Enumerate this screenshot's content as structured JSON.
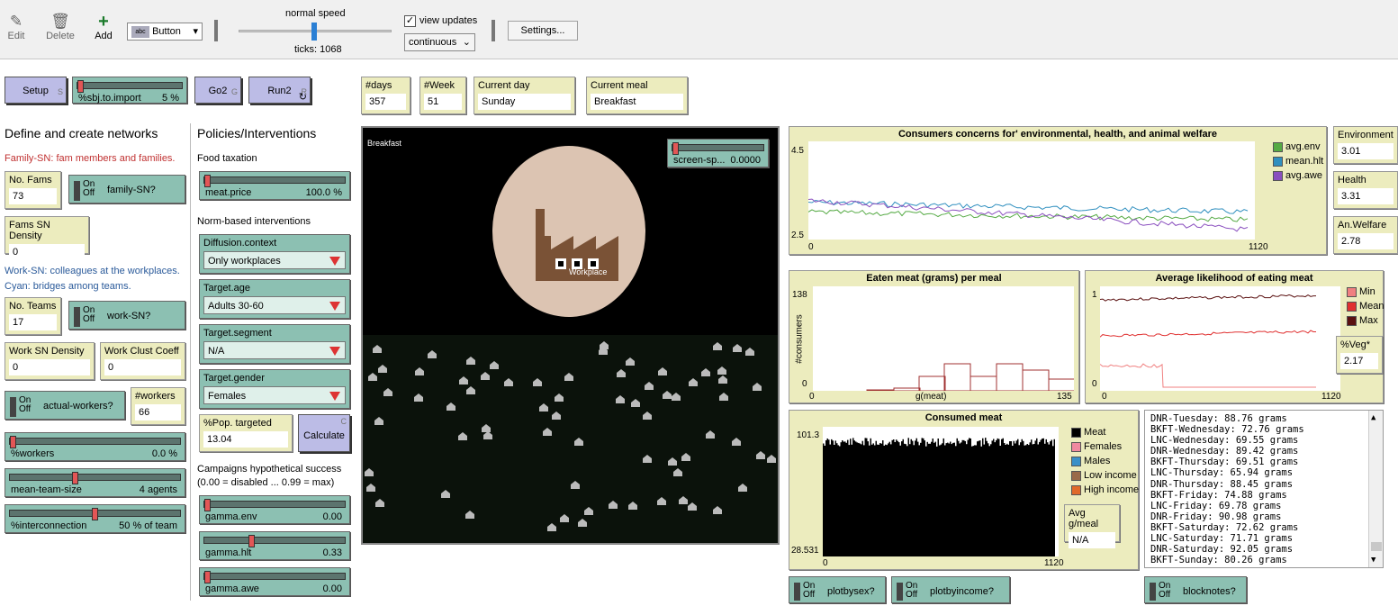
{
  "toolbar": {
    "edit": "Edit",
    "delete": "Delete",
    "add": "Add",
    "widget_type": "Button",
    "speed": "normal speed",
    "ticks": "ticks: 1068",
    "view_updates": "view updates",
    "update_mode": "continuous",
    "settings": "Settings..."
  },
  "buttons": {
    "setup": "Setup",
    "setup_key": "S",
    "go2": "Go2",
    "go2_key": "G",
    "run2": "Run2",
    "run2_key": "R",
    "calculate": "Calculate",
    "calculate_key": "C"
  },
  "monitors": {
    "days": {
      "label": "#days",
      "value": "357"
    },
    "week": {
      "label": "#Week",
      "value": "51"
    },
    "current_day": {
      "label": "Current day",
      "value": "Sunday"
    },
    "current_meal": {
      "label": "Current meal",
      "value": "Breakfast"
    },
    "no_fams": {
      "label": "No. Fams",
      "value": "73"
    },
    "fams_density": {
      "label": "Fams SN Density",
      "value": "0"
    },
    "no_teams": {
      "label": "No. Teams",
      "value": "17"
    },
    "work_density": {
      "label": "Work SN Density",
      "value": "0"
    },
    "work_clust": {
      "label": "Work Clust Coeff",
      "value": "0"
    },
    "workers": {
      "label": "#workers",
      "value": "66"
    },
    "pop_targeted": {
      "label": "%Pop. targeted",
      "value": "13.04"
    },
    "environment": {
      "label": "Environment",
      "value": "3.01"
    },
    "health": {
      "label": "Health",
      "value": "3.31"
    },
    "an_welfare": {
      "label": "An.Welfare",
      "value": "2.78"
    },
    "veg": {
      "label": "%Veg*",
      "value": "2.17"
    },
    "avg_gmeal": {
      "label": "Avg g/meal",
      "value": "N/A"
    }
  },
  "sliders": {
    "sbj_import": {
      "label": "%sbj.to.import",
      "value": "5 %",
      "fraction": 0.0
    },
    "meat_price": {
      "label": "meat.price",
      "value": "100.0 %",
      "fraction": 0.0
    },
    "workers_pct": {
      "label": "%workers",
      "value": "0.0 %",
      "fraction": 0.0
    },
    "team_size": {
      "label": "mean-team-size",
      "value": "4 agents",
      "fraction": 0.38
    },
    "interconnection": {
      "label": "%interconnection",
      "value": "50 % of team",
      "fraction": 0.5
    },
    "gamma_env": {
      "label": "gamma.env",
      "value": "0.00",
      "fraction": 0.0
    },
    "gamma_hlt": {
      "label": "gamma.hlt",
      "value": "0.33",
      "fraction": 0.33
    },
    "gamma_awe": {
      "label": "gamma.awe",
      "value": "0.00",
      "fraction": 0.0
    },
    "screen_speed": {
      "label": "screen-sp...",
      "value": "0.0000",
      "fraction": 0.0
    }
  },
  "switches": {
    "on": "On",
    "off": "Off",
    "family_sn": "family-SN?",
    "work_sn": "work-SN?",
    "actual_workers": "actual-workers?",
    "plotbysex": "plotbysex?",
    "plotbyincome": "plotbyincome?",
    "blocknotes": "blocknotes?"
  },
  "choosers": {
    "diffusion": {
      "label": "Diffusion.context",
      "value": "Only workplaces"
    },
    "age": {
      "label": "Target.age",
      "value": "Adults 30-60"
    },
    "segment": {
      "label": "Target.segment",
      "value": "N/A"
    },
    "gender": {
      "label": "Target.gender",
      "value": "Females"
    }
  },
  "notes": {
    "networks_title": "Define and create networks",
    "family_desc": "Family-SN: fam members and families.",
    "work_desc1": "Work-SN: colleagues at the workplaces.",
    "work_desc2": "Cyan: bridges among teams.",
    "policies_title": "Policies/Interventions",
    "food_tax": "Food taxation",
    "norm_based": "Norm-based interventions",
    "campaigns1": "Campaigns hypothetical success",
    "campaigns2": "(0.00 = disabled ... 0.99 = max)"
  },
  "view": {
    "meal_label": "Breakfast",
    "workplace_label": "Workplace"
  },
  "plots": {
    "concerns": {
      "title": "Consumers concerns for' environmental, health, and animal welfare",
      "ymax": "4.5",
      "ymin": "2.5",
      "xmin": "0",
      "xmax": "1120",
      "legend": [
        {
          "name": "avg.env",
          "color": "#55aa44"
        },
        {
          "name": "mean.hlt",
          "color": "#2f8fbf"
        },
        {
          "name": "avg.awe",
          "color": "#8a4fbf"
        }
      ]
    },
    "eaten": {
      "title": "Eaten meat (grams) per meal",
      "ymax": "138",
      "ymin": "0",
      "xmin": "0",
      "xmax": "135",
      "xlabel": "g(meat)",
      "ylabel": "#consumers"
    },
    "likelihood": {
      "title": "Average likelihood of eating meat",
      "ymax": "1",
      "ymin": "0",
      "xmin": "0",
      "xmax": "1120",
      "legend": [
        {
          "name": "Min",
          "color": "#f08080"
        },
        {
          "name": "Mean",
          "color": "#e03030"
        },
        {
          "name": "Max",
          "color": "#5a1010"
        }
      ]
    },
    "consumed": {
      "title": "Consumed meat",
      "ymax": "101.3",
      "ymin": "28.531",
      "xmin": "0",
      "xmax": "1120",
      "legend": [
        {
          "name": "Meat",
          "color": "#000000"
        },
        {
          "name": "Females",
          "color": "#f08aa0"
        },
        {
          "name": "Males",
          "color": "#3a8fc8"
        },
        {
          "name": "Low income",
          "color": "#9a6a4a"
        },
        {
          "name": "High income",
          "color": "#e06a2a"
        }
      ]
    }
  },
  "output_lines": [
    "DNR-Tuesday: 88.76 grams",
    "BKFT-Wednesday: 72.76 grams",
    "LNC-Wednesday: 69.55 grams",
    "DNR-Wednesday: 89.42 grams",
    "BKFT-Thursday: 69.51 grams",
    "LNC-Thursday: 65.94 grams",
    "DNR-Thursday: 88.45 grams",
    "BKFT-Friday: 74.88 grams",
    "LNC-Friday: 69.78 grams",
    "DNR-Friday: 90.98 grams",
    "BKFT-Saturday: 72.62 grams",
    "LNC-Saturday: 71.71 grams",
    "DNR-Saturday: 92.05 grams",
    "BKFT-Sunday: 80.26 grams"
  ]
}
